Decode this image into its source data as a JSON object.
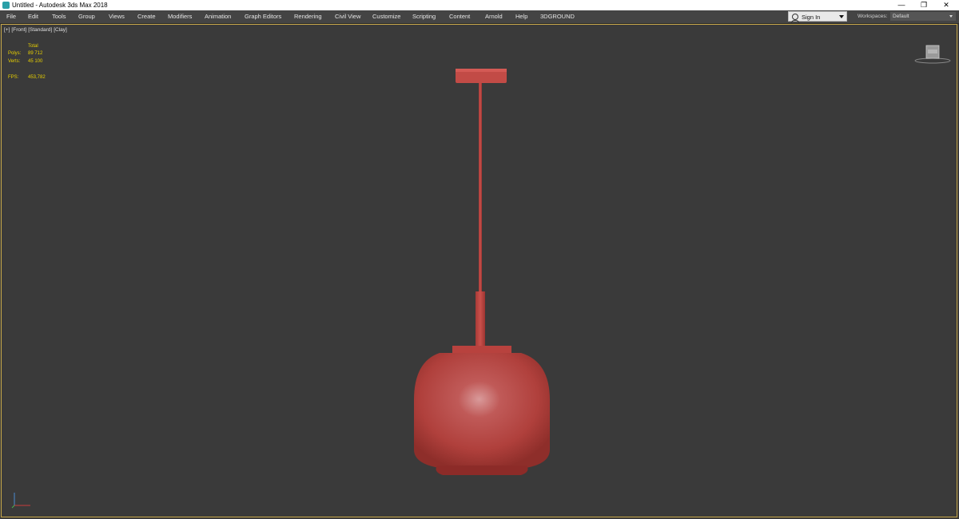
{
  "window": {
    "title": "Untitled - Autodesk 3ds Max 2018",
    "app_icon": "3ds-max-icon",
    "controls": {
      "minimize": "—",
      "restore": "❐",
      "close": "✕"
    }
  },
  "menubar": {
    "items": [
      "File",
      "Edit",
      "Tools",
      "Group",
      "Views",
      "Create",
      "Modifiers",
      "Animation",
      "Graph Editors",
      "Rendering",
      "Civil View",
      "Customize",
      "Scripting",
      "Content",
      "Arnold",
      "Help",
      "3DGROUND"
    ],
    "sign_in": "Sign In",
    "workspaces_label": "Workspaces:",
    "workspace_value": "Default"
  },
  "viewport": {
    "label_parts": [
      "[+]",
      "[Front]",
      "[Standard]",
      "[Clay]"
    ],
    "stats": {
      "header": "Total",
      "polys_label": "Polys:",
      "polys_value": "89 712",
      "verts_label": "Verts:",
      "verts_value": "45 100",
      "fps_label": "FPS:",
      "fps_value": "453,782"
    },
    "colors": {
      "background": "#3a3a3a",
      "border": "#c8a84a",
      "stats": "#e8d000",
      "model": "#b8423e"
    }
  }
}
